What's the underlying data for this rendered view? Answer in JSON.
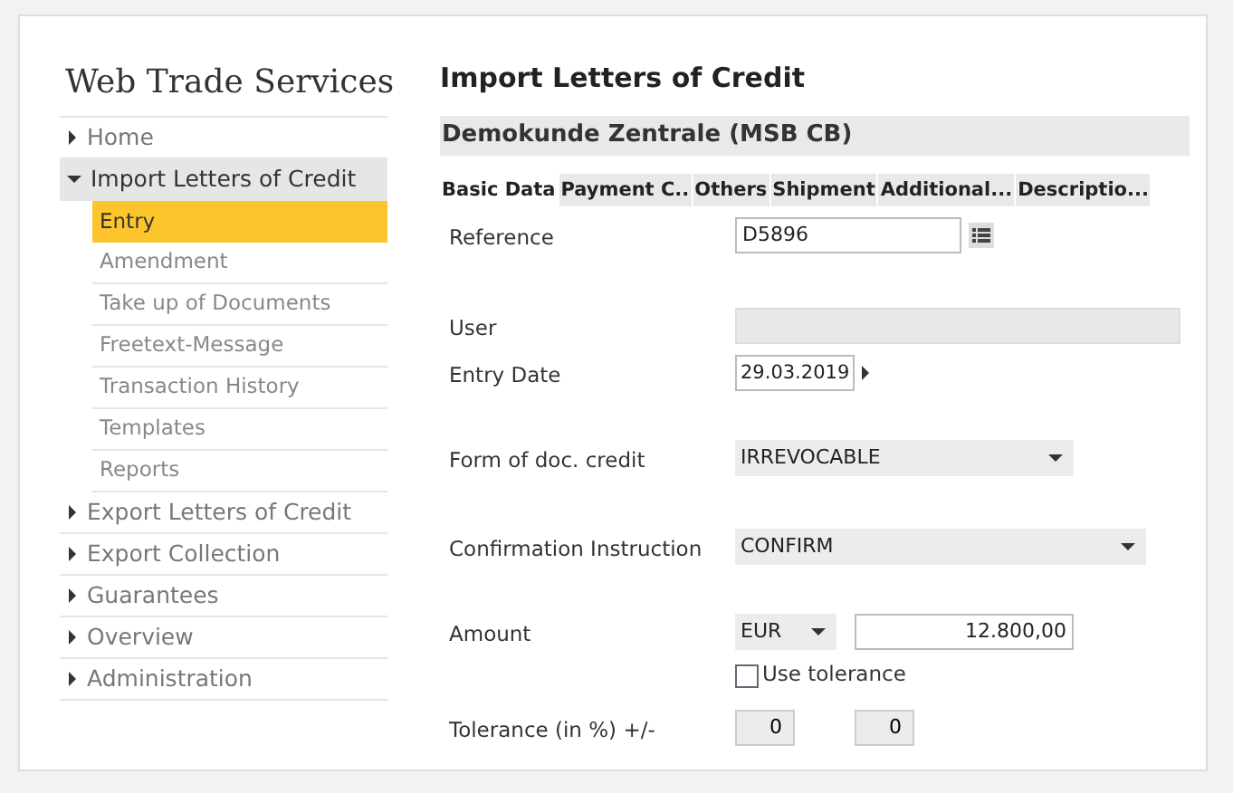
{
  "app_title": "Web Trade Services",
  "sidebar": {
    "items": [
      {
        "label": "Home",
        "expanded": false
      },
      {
        "label": "Import Letters of Credit",
        "expanded": true,
        "children": [
          {
            "label": "Entry",
            "selected": true
          },
          {
            "label": "Amendment",
            "selected": false
          },
          {
            "label": "Take up of Documents",
            "selected": false
          },
          {
            "label": "Freetext-Message",
            "selected": false
          },
          {
            "label": "Transaction History",
            "selected": false
          },
          {
            "label": "Templates",
            "selected": false
          },
          {
            "label": "Reports",
            "selected": false
          }
        ]
      },
      {
        "label": "Export Letters of Credit",
        "expanded": false
      },
      {
        "label": "Export Collection",
        "expanded": false
      },
      {
        "label": "Guarantees",
        "expanded": false
      },
      {
        "label": "Overview",
        "expanded": false
      },
      {
        "label": "Administration",
        "expanded": false
      }
    ]
  },
  "page_title": "Import Letters of Credit",
  "customer": "Demokunde Zentrale (MSB CB)",
  "tabs": [
    {
      "label": "Basic Data",
      "selected": true
    },
    {
      "label": "Payment C..",
      "selected": false
    },
    {
      "label": "Others",
      "selected": false
    },
    {
      "label": "Shipment",
      "selected": false
    },
    {
      "label": "Additional...",
      "selected": false
    },
    {
      "label": "Descriptio...",
      "selected": false
    }
  ],
  "fields": [
    {
      "kind": "lookup",
      "label": "Reference",
      "value": "D5896"
    },
    {
      "kind": "readonly",
      "label": "User"
    },
    {
      "kind": "date",
      "label": "Entry Date",
      "value": "29.03.2019"
    },
    {
      "kind": "select",
      "label": "Form of doc. credit",
      "value": "IRREVOCABLE"
    },
    {
      "kind": "select_wide",
      "label": "Confirmation Instruction",
      "value": "CONFIRM"
    },
    {
      "kind": "amount",
      "label": "Amount",
      "currency": "EUR",
      "value": "12.800,00"
    },
    {
      "kind": "checkbox",
      "label": "Use tolerance",
      "checked": false
    },
    {
      "kind": "range",
      "label": "Tolerance (in %) +/-",
      "min": "0",
      "max": "0"
    }
  ]
}
